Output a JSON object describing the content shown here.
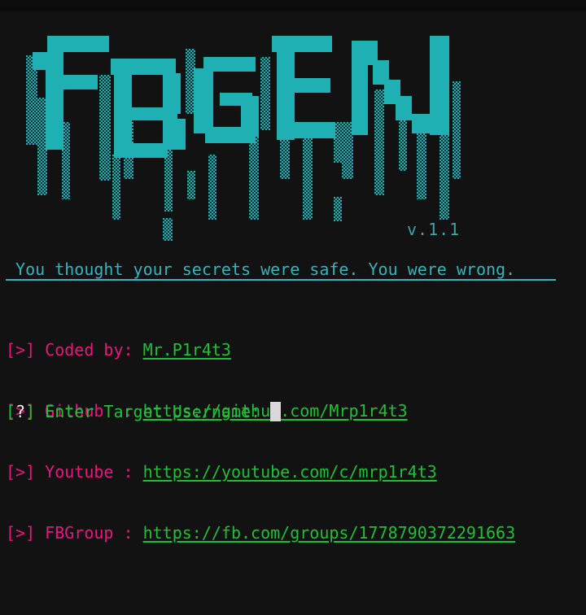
{
  "banner": {
    "logo_text": "FBGEN",
    "version": "v.1.1",
    "tagline": " You thought your secrets were safe. You were wrong."
  },
  "info": [
    {
      "prefix": "[>]",
      "label": " Coded by: ",
      "value": "Mr.P1r4t3"
    },
    {
      "prefix": "[>]",
      "label": " Github  : ",
      "value": "https://github.com/Mrp1r4t3"
    },
    {
      "prefix": "[>]",
      "label": " Youtube : ",
      "value": "https://youtube.com/c/mrp1r4t3"
    },
    {
      "prefix": "[>]",
      "label": " FBGroup : ",
      "value": "https://fb.com/groups/1778790372291663"
    }
  ],
  "prompt": {
    "open_bracket": "[",
    "mark": "?",
    "close_bracket": "]",
    "text": " Enter Target Username: ",
    "input_value": ""
  },
  "colors": {
    "background": "#121212",
    "logo_cyan": "#1fb0b4",
    "pink": "#e8177c",
    "green": "#21bf38",
    "cyan_text": "#36b3bb"
  }
}
